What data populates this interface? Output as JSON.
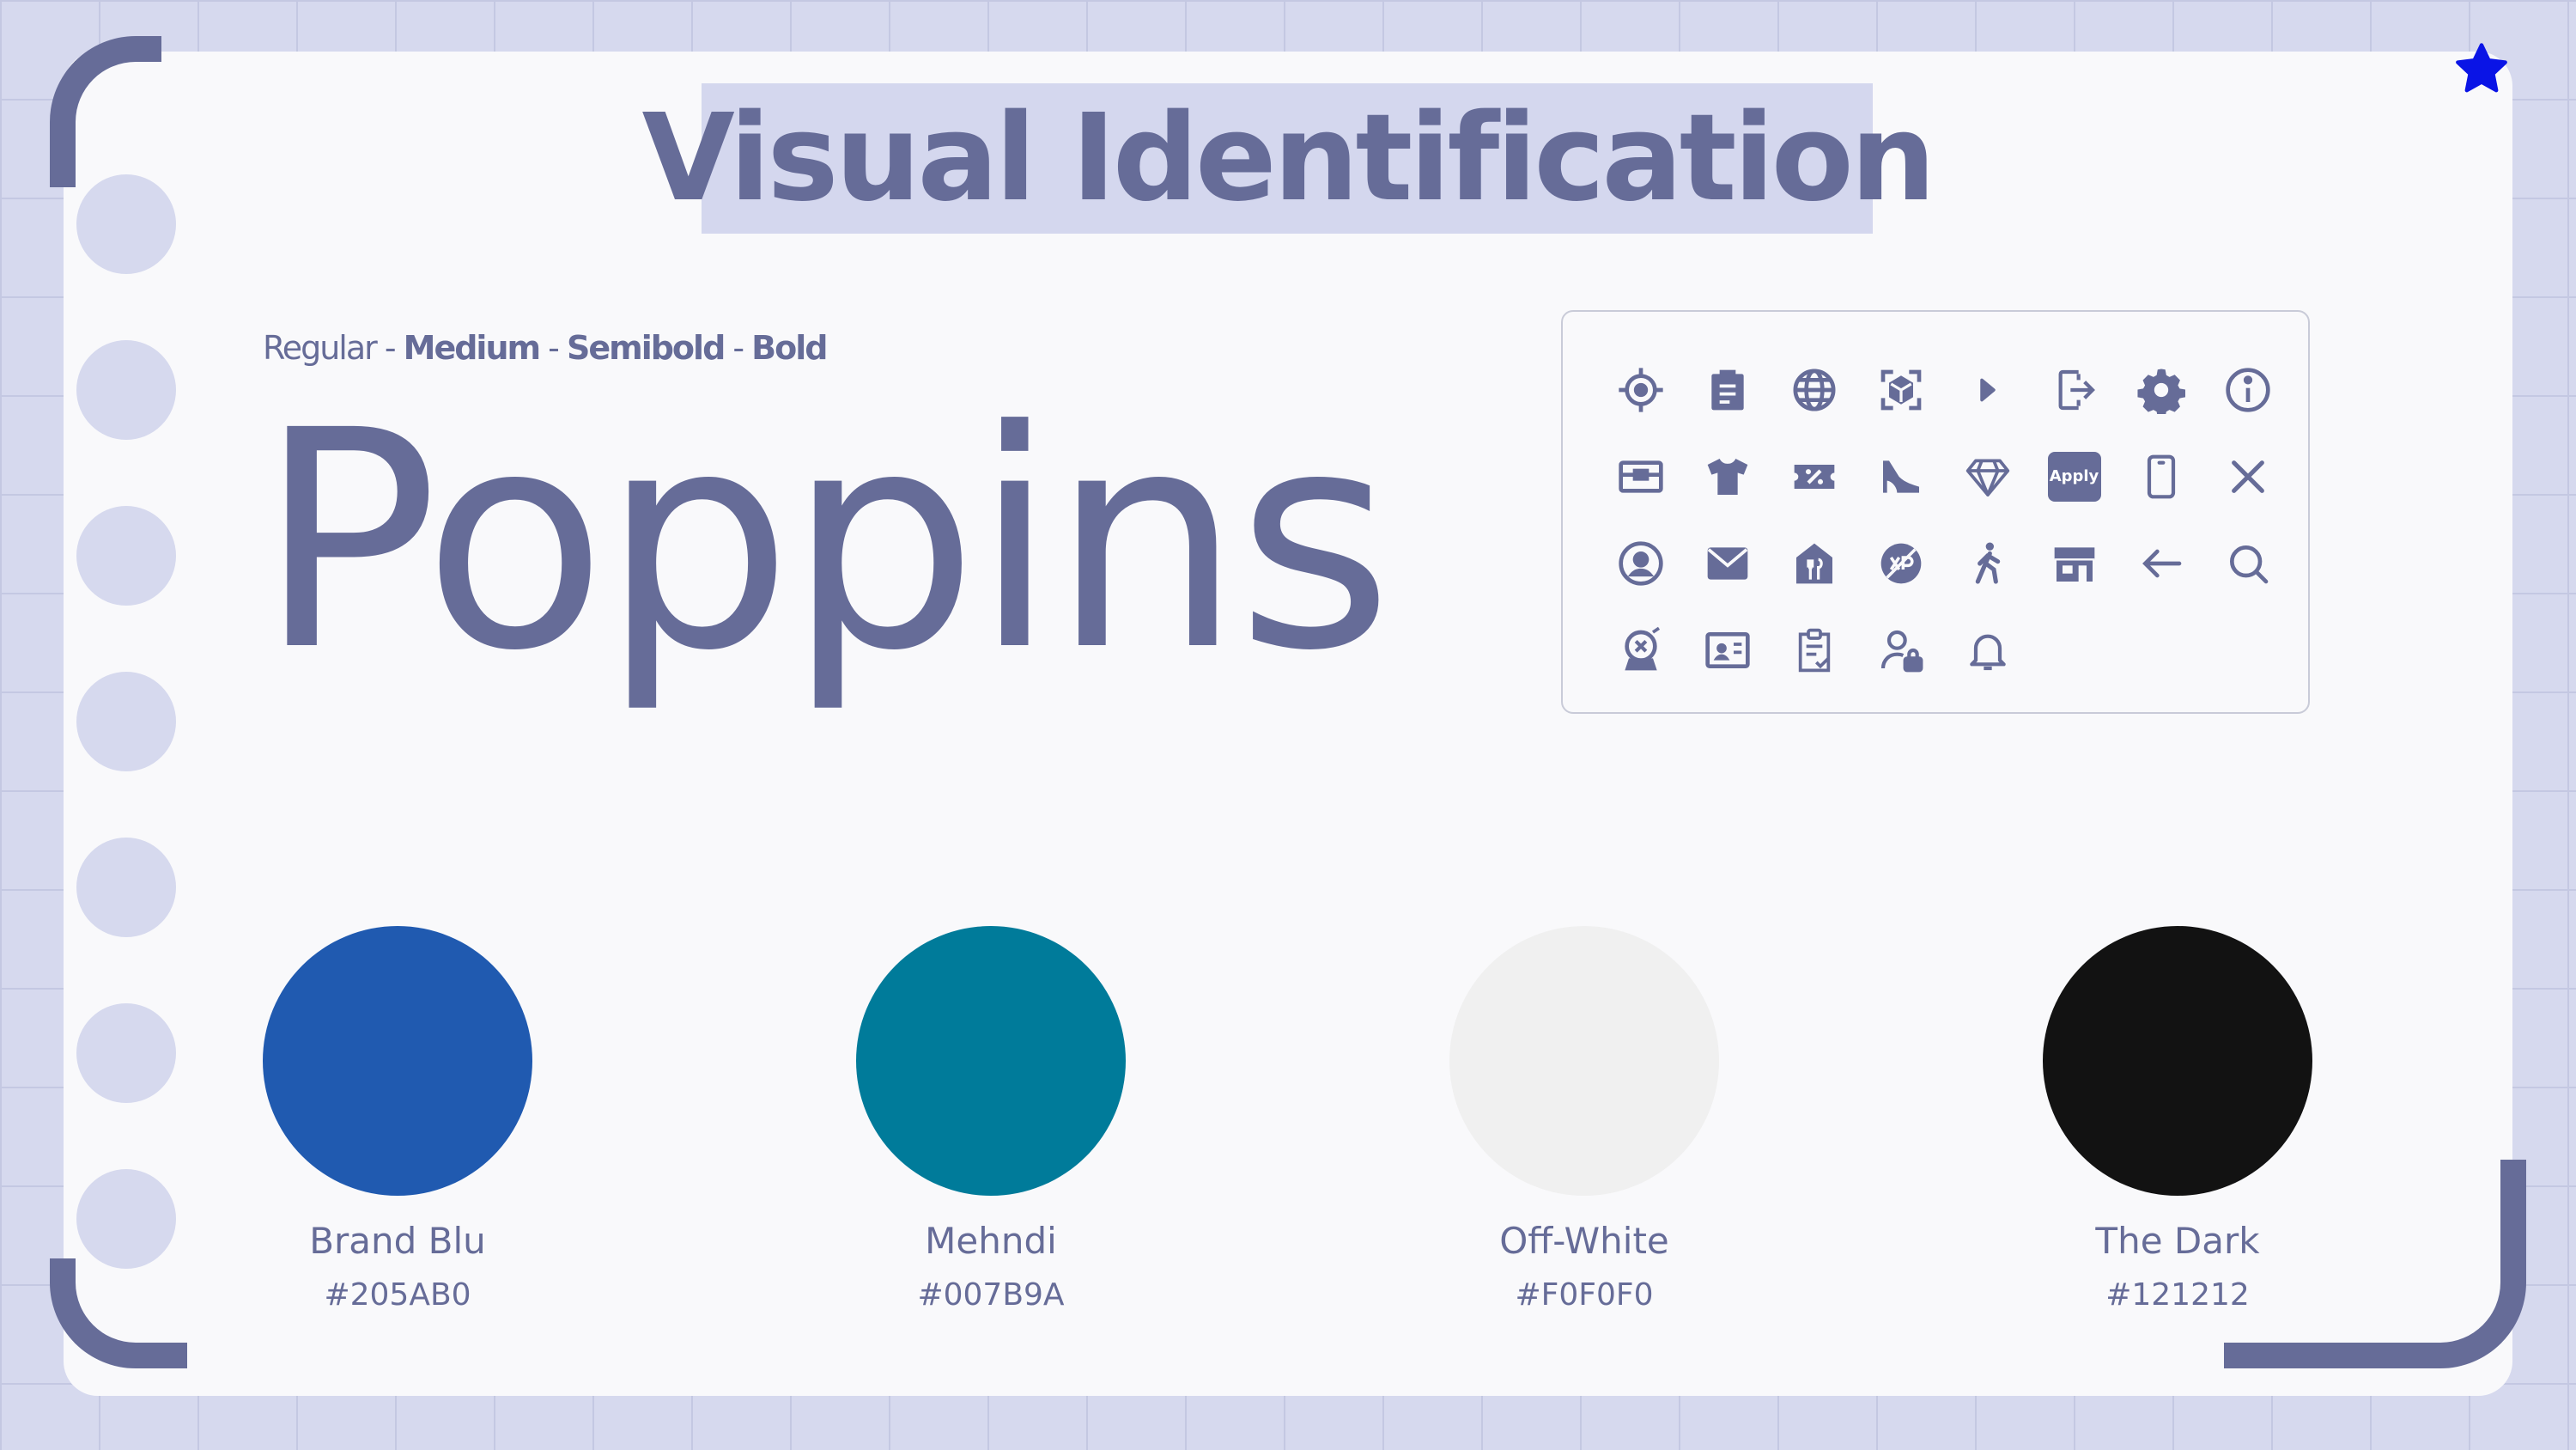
{
  "title": "Visual Identification",
  "typography": {
    "weights": [
      "Regular",
      "Medium",
      "Semibold",
      "Bold"
    ],
    "separator": " - ",
    "font_name": "Poppins"
  },
  "icons": [
    "crosshair-icon",
    "clipboard-icon",
    "globe-icon",
    "scan-box-icon",
    "play-arrow-icon",
    "logout-icon",
    "gear-icon",
    "info-icon",
    "wallet-icon",
    "tshirt-icon",
    "ticket-percent-icon",
    "high-heel-icon",
    "diamond-icon",
    "apply-badge",
    "phone-icon",
    "close-icon",
    "user-circle-icon",
    "mail-icon",
    "restaurant-home-icon",
    "no-xp-icon",
    "walking-icon",
    "store-icon",
    "arrow-left-icon",
    "search-icon",
    "badge-x-icon",
    "id-card-icon",
    "clipboard-check-icon",
    "user-lock-icon",
    "bell-icon"
  ],
  "apply_label": "Apply",
  "palette": [
    {
      "name": "Brand Blu",
      "hex": "#205AB0",
      "color": "#205AB0"
    },
    {
      "name": "Mehndi",
      "hex": "#007B9A",
      "color": "#007B9A"
    },
    {
      "name": "Off-White",
      "hex": "#F0F0F0",
      "color": "#F0F0F0"
    },
    {
      "name": "The Dark",
      "hex": "#121212",
      "color": "#121212"
    }
  ],
  "colors": {
    "accent": "#666C98",
    "background": "#D6D9EE",
    "card": "#F9F9FB",
    "star": "#0A14E6"
  }
}
